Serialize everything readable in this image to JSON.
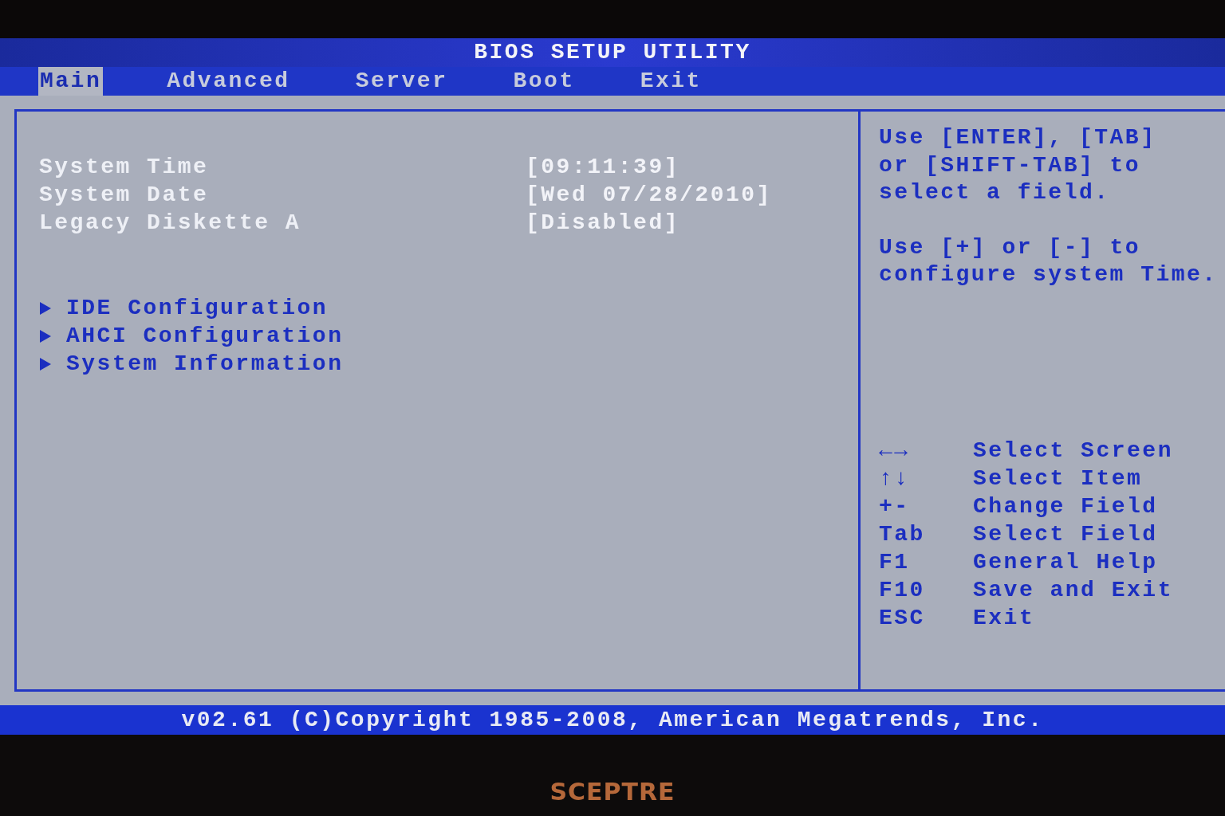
{
  "window": {
    "title": "BIOS SETUP UTILITY"
  },
  "tabs": [
    {
      "label": "Main",
      "selected": true
    },
    {
      "label": "Advanced",
      "selected": false
    },
    {
      "label": "Server",
      "selected": false
    },
    {
      "label": "Boot",
      "selected": false
    },
    {
      "label": "Exit",
      "selected": false
    }
  ],
  "settings": [
    {
      "label": "System Time",
      "value": "[09:11:39]"
    },
    {
      "label": "System Date",
      "value": "[Wed 07/28/2010]"
    },
    {
      "label": "Legacy Diskette A",
      "value": "[Disabled]"
    }
  ],
  "submenus": [
    {
      "label": "IDE Configuration"
    },
    {
      "label": "AHCI Configuration"
    },
    {
      "label": "System Information"
    }
  ],
  "help": [
    "Use [ENTER], [TAB]\nor [SHIFT-TAB] to\nselect a field.",
    "Use [+] or [-] to\nconfigure system Time."
  ],
  "keys": [
    {
      "key": "←→",
      "action": "Select Screen"
    },
    {
      "key": "↑↓",
      "action": "Select Item"
    },
    {
      "key": "+-",
      "action": "Change Field"
    },
    {
      "key": "Tab",
      "action": "Select Field"
    },
    {
      "key": "F1",
      "action": "General Help"
    },
    {
      "key": "F10",
      "action": "Save and Exit"
    },
    {
      "key": "ESC",
      "action": "Exit"
    }
  ],
  "footer": "v02.61 (C)Copyright 1985-2008, American Megatrends, Inc.",
  "monitor_brand": "SCEPTRE"
}
